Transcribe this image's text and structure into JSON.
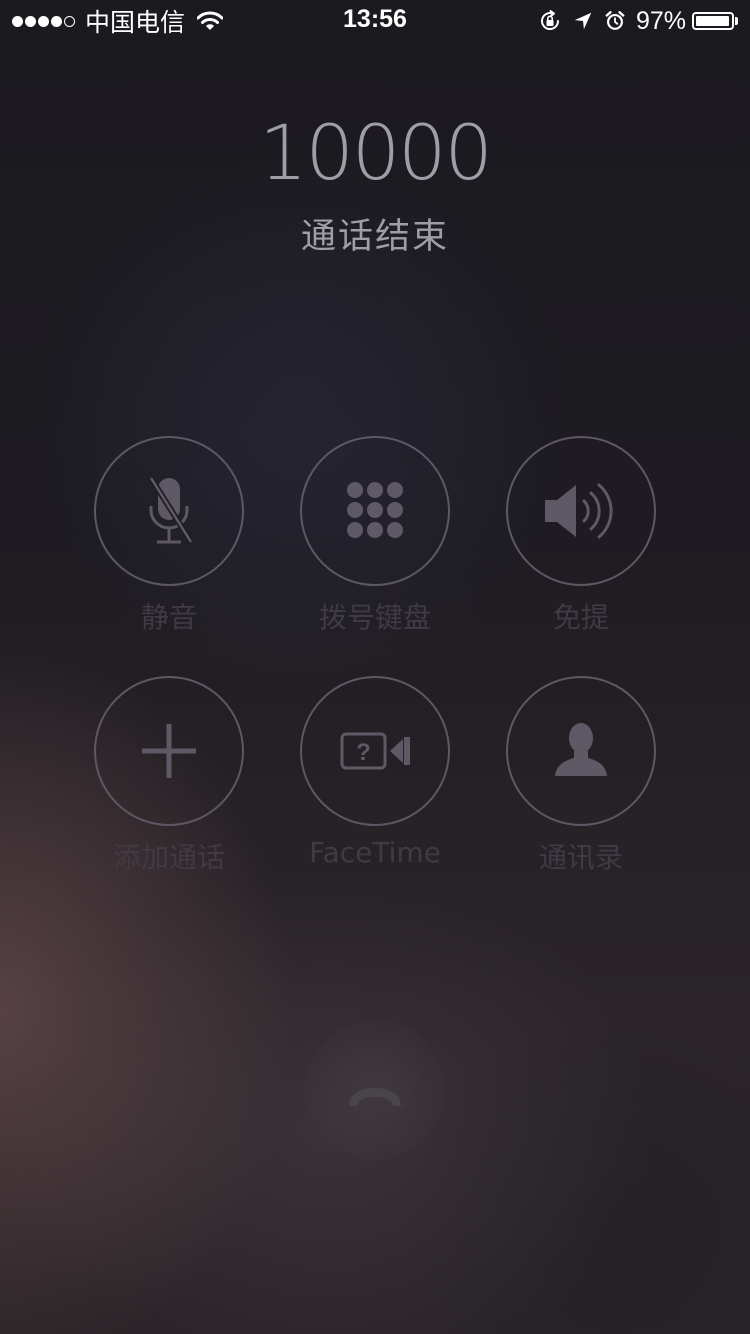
{
  "status_bar": {
    "signal_filled": 4,
    "signal_total": 5,
    "carrier": "中国电信",
    "time": "13:56",
    "battery_percent": "97%",
    "battery_level": 0.97,
    "icons": [
      "wifi-icon",
      "orientation-lock-icon",
      "location-arrow-icon",
      "alarm-icon",
      "battery-icon"
    ]
  },
  "call": {
    "number": "10000",
    "status": "通话结束"
  },
  "controls": {
    "mute": {
      "label": "静音",
      "icon": "muted-microphone-icon"
    },
    "keypad": {
      "label": "拨号键盘",
      "icon": "keypad-icon"
    },
    "speaker": {
      "label": "免提",
      "icon": "speaker-icon"
    },
    "add_call": {
      "label": "添加通话",
      "icon": "plus-icon"
    },
    "facetime": {
      "label": "FaceTime",
      "icon": "facetime-unavailable-icon"
    },
    "contacts": {
      "label": "通讯录",
      "icon": "contact-person-icon"
    }
  },
  "end_call": {
    "icon": "end-call-phone-icon"
  },
  "colors": {
    "ring": "#5e5864",
    "icon": "#5f5966",
    "label": "#3f3a44",
    "caller_text": "#9f9ea6"
  }
}
